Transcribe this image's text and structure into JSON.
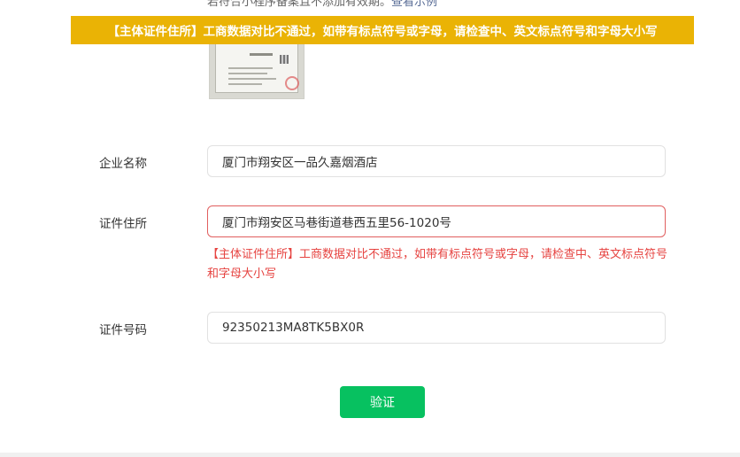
{
  "hint": {
    "text": "若符合小程序备案且不添加有效期。",
    "link": "查看示例"
  },
  "banner": {
    "text": "【主体证件住所】工商数据对比不通过，如带有标点符号或字母，请检查中、英文标点符号和字母大小写"
  },
  "form": {
    "company_name": {
      "label": "企业名称",
      "value": "厦门市翔安区一品久嘉烟酒店"
    },
    "address": {
      "label": "证件住所",
      "value": "厦门市翔安区马巷街道巷西五里56-1020号",
      "error": "【主体证件住所】工商数据对比不通过，如带有标点符号或字母，请检查中、英文标点符号和字母大小写"
    },
    "license_number": {
      "label": "证件号码",
      "value": "92350213MA8TK5BX0R"
    },
    "verify_label": "验证"
  },
  "colors": {
    "banner_bg": "#eab305",
    "error": "#e64340",
    "primary": "#07c160"
  }
}
